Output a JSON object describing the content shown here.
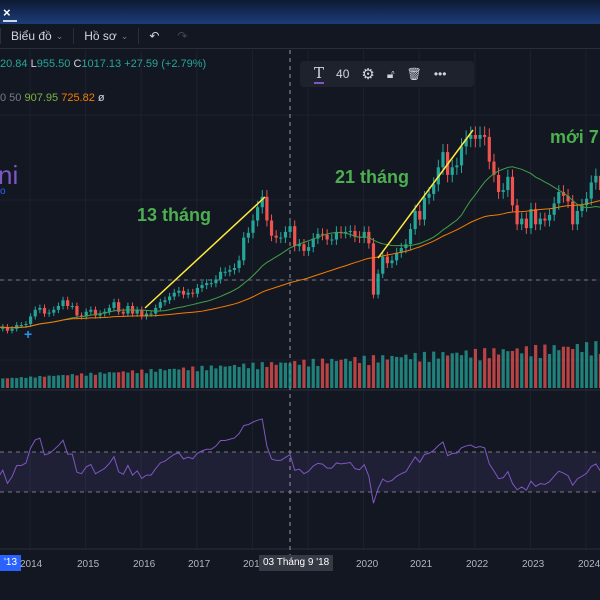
{
  "window": {
    "tab_close": "×"
  },
  "toolbar": {
    "chart_label": "Biểu đồ",
    "profile_label": "Hồ sơ",
    "undo_icon": "undo-icon",
    "redo_icon": "redo-icon"
  },
  "legend": {
    "ohlc_prefix": "20.84",
    "low_label": "L",
    "low": "955.50",
    "close_label": "C",
    "close": "1017.13",
    "change": "+27.59 (+2.79%)",
    "ma_prefix": "0 50",
    "ma1": "907.95",
    "ma2": "725.82",
    "ma_suffix": "ø"
  },
  "drawing_toolbar": {
    "text_icon": "text-icon",
    "font_size": "40",
    "accent": "#7e57c2"
  },
  "annotations": {
    "a1": "13 tháng",
    "a2": "21 tháng",
    "a3": "mới 7",
    "brand": "ni",
    "brand_sub": "o"
  },
  "time_axis": {
    "start_label": "'13",
    "labels": [
      "2014",
      "2015",
      "2016",
      "2017",
      "201",
      "2020",
      "2021",
      "2022",
      "2023",
      "2024"
    ],
    "crosshair_label": "03 Tháng 9 '18"
  },
  "colors": {
    "up": "#26a69a",
    "down": "#ef5350",
    "ma_short": "#43a047",
    "ma_long": "#f57c00",
    "rsi": "#7e57c2",
    "trendline": "#ffeb3b"
  },
  "chart_data": {
    "type": "candlestick",
    "interval": "monthly",
    "start": "2013-01",
    "closes": [
      480,
      490,
      470,
      500,
      510,
      480,
      490,
      470,
      480,
      500,
      500,
      505,
      545,
      580,
      590,
      560,
      565,
      580,
      600,
      630,
      600,
      600,
      550,
      545,
      570,
      580,
      550,
      560,
      570,
      590,
      620,
      570,
      560,
      600,
      560,
      580,
      545,
      560,
      560,
      590,
      620,
      630,
      650,
      670,
      680,
      660,
      670,
      665,
      695,
      710,
      720,
      720,
      740,
      780,
      780,
      790,
      800,
      840,
      960,
      985,
      1050,
      1120,
      1175,
      1050,
      970,
      960,
      960,
      990,
      1020,
      915,
      925,
      890,
      910,
      955,
      980,
      975,
      950,
      950,
      990,
      985,
      990,
      995,
      965,
      960,
      990,
      930,
      660,
      770,
      860,
      825,
      840,
      880,
      905,
      925,
      1005,
      1100,
      1055,
      1170,
      1190,
      1240,
      1330,
      1410,
      1290,
      1330,
      1340,
      1440,
      1480,
      1500,
      1480,
      1500,
      1490,
      1360,
      1290,
      1200,
      1210,
      1280,
      1130,
      1030,
      1060,
      1010,
      1110,
      1030,
      1060,
      1050,
      1080,
      1140,
      1200,
      1180,
      1150,
      1030,
      1100,
      1130,
      1165,
      1250,
      1285,
      1210,
      1260,
      1240
    ],
    "indicators": [
      "MA 20",
      "MA 50",
      "Volume",
      "RSI"
    ]
  }
}
